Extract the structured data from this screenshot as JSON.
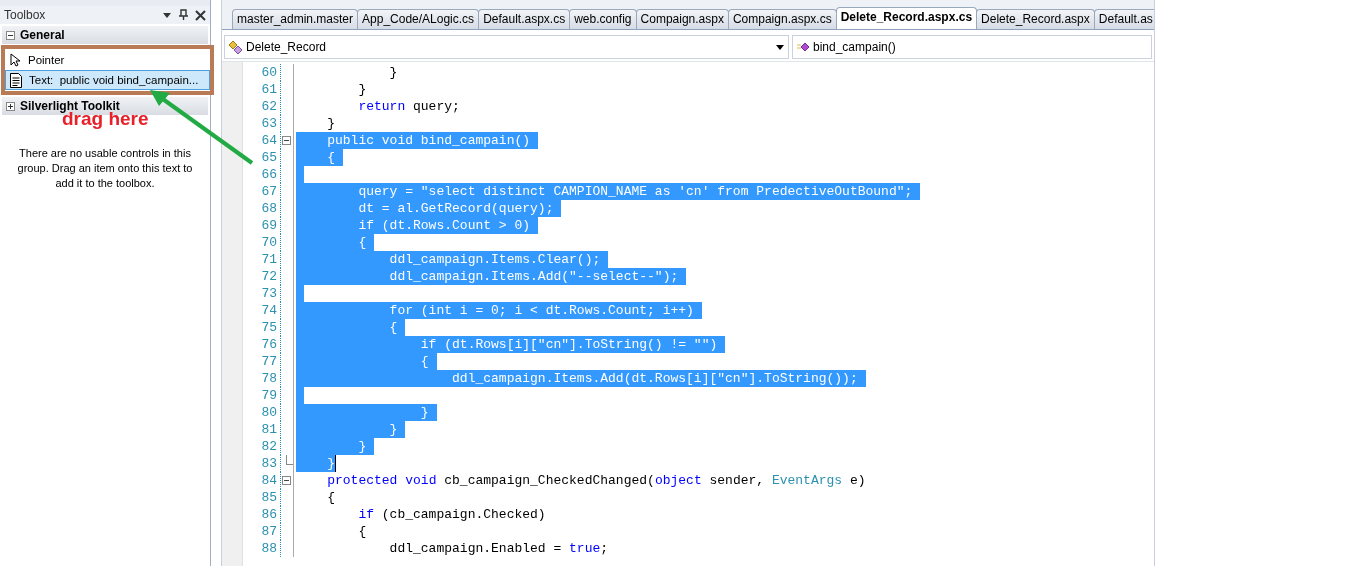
{
  "toolbox": {
    "title": "Toolbox",
    "groups": [
      {
        "name": "General",
        "expanded": true,
        "items": [
          {
            "label": "Pointer",
            "kind": "pointer",
            "selected": false
          },
          {
            "label": "Text:  public void bind_campain...",
            "kind": "text",
            "selected": true
          }
        ]
      },
      {
        "name": "Silverlight Toolkit",
        "expanded": false
      }
    ],
    "message": "There are no usable controls in this group. Drag an item onto this text to add it to the toolbox."
  },
  "tabs": [
    {
      "label": "master_admin.master",
      "selected": false
    },
    {
      "label": "App_Code/ALogic.cs",
      "selected": false
    },
    {
      "label": "Default.aspx.cs",
      "selected": false
    },
    {
      "label": "web.config",
      "selected": false
    },
    {
      "label": "Compaign.aspx",
      "selected": false
    },
    {
      "label": "Compaign.aspx.cs",
      "selected": false
    },
    {
      "label": "Delete_Record.aspx.cs",
      "selected": true
    },
    {
      "label": "Delete_Record.aspx",
      "selected": false
    },
    {
      "label": "Default.as",
      "selected": false
    }
  ],
  "navigation": {
    "type_dropdown": "Delete_Record",
    "member_dropdown": "bind_campain()"
  },
  "code_lines": [
    {
      "number": "60",
      "segments": [
        {
          "text": "            }",
          "kind": "plain",
          "selected": false
        }
      ],
      "eol_selected": false,
      "fold_start": false,
      "fold_end": false,
      "cursor": false
    },
    {
      "number": "61",
      "segments": [
        {
          "text": "        }",
          "kind": "plain",
          "selected": false
        }
      ],
      "eol_selected": false,
      "fold_start": false,
      "fold_end": false,
      "cursor": false
    },
    {
      "number": "62",
      "segments": [
        {
          "text": "        return",
          "kind": "keyword",
          "selected": false
        },
        {
          "text": " query;",
          "kind": "plain",
          "selected": false
        }
      ],
      "eol_selected": false,
      "fold_start": false,
      "fold_end": false,
      "cursor": false
    },
    {
      "number": "63",
      "segments": [
        {
          "text": "    }",
          "kind": "plain",
          "selected": false
        }
      ],
      "eol_selected": false,
      "fold_start": false,
      "fold_end": false,
      "cursor": false
    },
    {
      "number": "64",
      "segments": [
        {
          "text": "    public void bind_campain()",
          "kind": "plain",
          "selected": true
        }
      ],
      "eol_selected": true,
      "fold_start": true,
      "fold_end": false,
      "cursor": false
    },
    {
      "number": "65",
      "segments": [
        {
          "text": "    {",
          "kind": "plain",
          "selected": true
        }
      ],
      "eol_selected": true,
      "fold_start": false,
      "fold_end": false,
      "cursor": false
    },
    {
      "number": "66",
      "eol_selected": true,
      "fold_start": false,
      "fold_end": false,
      "cursor": false
    },
    {
      "number": "67",
      "segments": [
        {
          "text": "        query = \"select distinct CAMPION_NAME as 'cn' from PredectiveOutBound\";",
          "kind": "plain",
          "selected": true
        }
      ],
      "eol_selected": true,
      "fold_start": false,
      "fold_end": false,
      "cursor": false
    },
    {
      "number": "68",
      "segments": [
        {
          "text": "        dt = al.GetRecord(query);",
          "kind": "plain",
          "selected": true
        }
      ],
      "eol_selected": true,
      "fold_start": false,
      "fold_end": false,
      "cursor": false
    },
    {
      "number": "69",
      "segments": [
        {
          "text": "        if (dt.Rows.Count > 0)",
          "kind": "plain",
          "selected": true
        }
      ],
      "eol_selected": true,
      "fold_start": false,
      "fold_end": false,
      "cursor": false
    },
    {
      "number": "70",
      "segments": [
        {
          "text": "        {",
          "kind": "plain",
          "selected": true
        }
      ],
      "eol_selected": true,
      "fold_start": false,
      "fold_end": false,
      "cursor": false
    },
    {
      "number": "71",
      "segments": [
        {
          "text": "            ddl_campaign.Items.Clear();",
          "kind": "plain",
          "selected": true
        }
      ],
      "eol_selected": true,
      "fold_start": false,
      "fold_end": false,
      "cursor": false
    },
    {
      "number": "72",
      "segments": [
        {
          "text": "            ddl_campaign.Items.Add(\"--select--\");",
          "kind": "plain",
          "selected": true
        }
      ],
      "eol_selected": true,
      "fold_start": false,
      "fold_end": false,
      "cursor": false
    },
    {
      "number": "73",
      "eol_selected": true,
      "fold_start": false,
      "fold_end": false,
      "cursor": false
    },
    {
      "number": "74",
      "segments": [
        {
          "text": "            for (int i = 0; i < dt.Rows.Count; i++)",
          "kind": "plain",
          "selected": true
        }
      ],
      "eol_selected": true,
      "fold_start": false,
      "fold_end": false,
      "cursor": false
    },
    {
      "number": "75",
      "segments": [
        {
          "text": "            {",
          "kind": "plain",
          "selected": true
        }
      ],
      "eol_selected": true,
      "fold_start": false,
      "fold_end": false,
      "cursor": false
    },
    {
      "number": "76",
      "segments": [
        {
          "text": "                if (dt.Rows[i][\"cn\"].ToString() != \"\")",
          "kind": "plain",
          "selected": true
        }
      ],
      "eol_selected": true,
      "fold_start": false,
      "fold_end": false,
      "cursor": false
    },
    {
      "number": "77",
      "segments": [
        {
          "text": "                {",
          "kind": "plain",
          "selected": true
        }
      ],
      "eol_selected": true,
      "fold_start": false,
      "fold_end": false,
      "cursor": false
    },
    {
      "number": "78",
      "segments": [
        {
          "text": "                    ddl_campaign.Items.Add(dt.Rows[i][\"cn\"].ToString());",
          "kind": "plain",
          "selected": true
        }
      ],
      "eol_selected": true,
      "fold_start": false,
      "fold_end": false,
      "cursor": false
    },
    {
      "number": "79",
      "eol_selected": true,
      "fold_start": false,
      "fold_end": false,
      "cursor": false
    },
    {
      "number": "80",
      "segments": [
        {
          "text": "                }",
          "kind": "plain",
          "selected": true
        }
      ],
      "eol_selected": true,
      "fold_start": false,
      "fold_end": false,
      "cursor": false
    },
    {
      "number": "81",
      "segments": [
        {
          "text": "            }",
          "kind": "plain",
          "selected": true
        }
      ],
      "eol_selected": true,
      "fold_start": false,
      "fold_end": false,
      "cursor": false
    },
    {
      "number": "82",
      "segments": [
        {
          "text": "        }",
          "kind": "plain",
          "selected": true
        }
      ],
      "eol_selected": true,
      "fold_start": false,
      "fold_end": false,
      "cursor": false
    },
    {
      "number": "83",
      "segments": [
        {
          "text": "    }",
          "kind": "plain",
          "selected": true
        }
      ],
      "eol_selected": false,
      "fold_start": false,
      "fold_end": true,
      "cursor": true
    },
    {
      "number": "84",
      "segments": [
        {
          "text": "    protected",
          "kind": "keyword",
          "selected": false
        },
        {
          "text": " void",
          "kind": "keyword",
          "selected": false
        },
        {
          "text": " cb_campaign_CheckedChanged(",
          "kind": "plain",
          "selected": false
        },
        {
          "text": "object",
          "kind": "keyword",
          "selected": false
        },
        {
          "text": " sender, ",
          "kind": "plain",
          "selected": false
        },
        {
          "text": "EventArgs",
          "kind": "type",
          "selected": false
        },
        {
          "text": " e)",
          "kind": "plain",
          "selected": false
        }
      ],
      "eol_selected": false,
      "fold_start": true,
      "fold_end": false,
      "cursor": false
    },
    {
      "number": "85",
      "segments": [
        {
          "text": "    {",
          "kind": "plain",
          "selected": false
        }
      ],
      "eol_selected": false,
      "fold_start": false,
      "fold_end": false,
      "cursor": false
    },
    {
      "number": "86",
      "segments": [
        {
          "text": "        if",
          "kind": "keyword",
          "selected": false
        },
        {
          "text": " (cb_campaign.Checked)",
          "kind": "plain",
          "selected": false
        }
      ],
      "eol_selected": false,
      "fold_start": false,
      "fold_end": false,
      "cursor": false
    },
    {
      "number": "87",
      "segments": [
        {
          "text": "        {",
          "kind": "plain",
          "selected": false
        }
      ],
      "eol_selected": false,
      "fold_start": false,
      "fold_end": false,
      "cursor": false
    },
    {
      "number": "88",
      "segments": [
        {
          "text": "            ddl_campaign.Enabled = ",
          "kind": "plain",
          "selected": false
        },
        {
          "text": "true",
          "kind": "keyword",
          "selected": false
        },
        {
          "text": ";",
          "kind": "plain",
          "selected": false
        }
      ],
      "eol_selected": false,
      "fold_start": false,
      "fold_end": false,
      "cursor": false
    }
  ],
  "annotation": {
    "text": "drag here"
  }
}
